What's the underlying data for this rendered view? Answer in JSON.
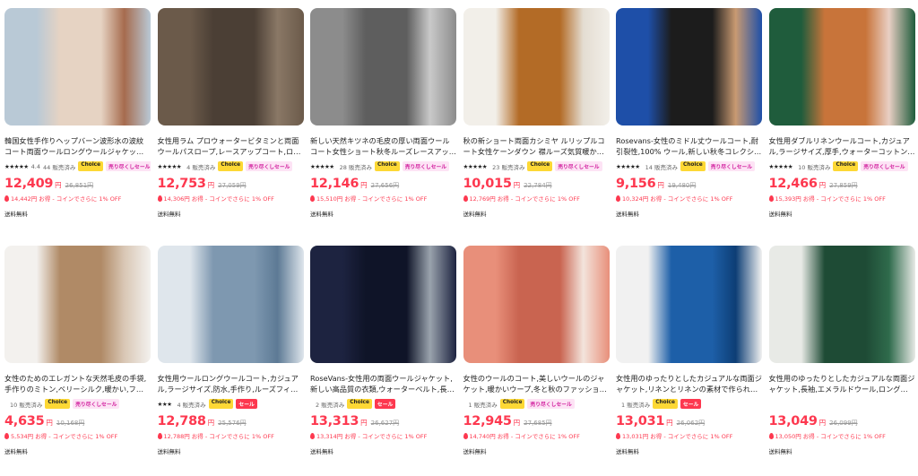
{
  "products": [
    {
      "title": "韓国女性手作りヘップバーン波形水の波紋コート両面ウールロングウールジャケットコート最大",
      "stars": "★★★★★",
      "rating": "4.4",
      "sold": "44 販売済み",
      "badges": [
        "Choice",
        "売り尽くしセール"
      ],
      "price": "12,409",
      "yen": "円",
      "old_price": "26,851円",
      "coin": "14,442円 お得 - コインでさらに 1% OFF",
      "shipping": "送料無料",
      "colors": [
        "#b9c9d6",
        "#e6d3c3",
        "#a66b4e"
      ]
    },
    {
      "title": "女性用ラム プロウォータービタミンと両面ウールパスロープ,レースアップコート,ロングウールコート,最...",
      "stars": "★★★★★",
      "rating": "",
      "sold": "4 販売済み",
      "badges": [
        "Choice",
        "売り尽くしセール"
      ],
      "price": "12,753",
      "yen": "円",
      "old_price": "27,059円",
      "coin": "14,306円 お得 - コインでさらに 1% OFF",
      "shipping": "送料無料",
      "colors": [
        "#6b5a4a",
        "#4b3f35",
        "#8a7866"
      ]
    },
    {
      "title": "新しい天然キツネの毛皮の厚い両面ウールコート女性ショート秋冬ルーズレースアップウールコ...",
      "stars": "★★★★★",
      "rating": "",
      "sold": "28 販売済み",
      "badges": [
        "Choice",
        "売り尽くしセール"
      ],
      "price": "12,146",
      "yen": "円",
      "old_price": "27,656円",
      "coin": "15,510円 お得 - コインでさらに 1% OFF",
      "shipping": "送料無料",
      "colors": [
        "#8c8c8c",
        "#5e5e5e",
        "#c9c9c9"
      ]
    },
    {
      "title": "秋の新ショート両面カシミヤ ルリップルコート女性ケーンダウン 襟ルーズ気質暖かいカジュアル...",
      "stars": "★★★★★",
      "rating": "",
      "sold": "23 販売済み",
      "badges": [
        "Choice",
        "売り尽くしセール"
      ],
      "price": "10,015",
      "yen": "円",
      "old_price": "22,784円",
      "coin": "12,769円 お得 - コインでさらに 1% OFF",
      "shipping": "送料無料",
      "colors": [
        "#f2efe9",
        "#b36b26",
        "#e4ddd2"
      ]
    },
    {
      "title": "Rosevans-女性のミドル丈ウールコート,耐引裂性,100% ウール,新しい秋冬コレクション",
      "stars": "★★★★★",
      "rating": "",
      "sold": "14 販売済み",
      "badges": [
        "Choice",
        "売り尽くしセール"
      ],
      "price": "9,156",
      "yen": "円",
      "old_price": "19,480円",
      "coin": "10,324円 お得 - コインでさらに 1% OFF",
      "shipping": "送料無料",
      "colors": [
        "#1e4fa8",
        "#1c1c1c",
        "#c99a72"
      ]
    },
    {
      "title": "女性用ダブルリネンウールコート,カジュアル,ラージサイズ,厚手,ウォーターコットン,ロングセクション,...",
      "stars": "★★★★★",
      "rating": "",
      "sold": "10 販売済み",
      "badges": [
        "Choice",
        "売り尽くしセール"
      ],
      "price": "12,466",
      "yen": "円",
      "old_price": "27,859円",
      "coin": "15,393円 お得 - コインでさらに 1% OFF",
      "shipping": "送料無料",
      "colors": [
        "#1f5c3c",
        "#c8743a",
        "#e9cfc4"
      ]
    },
    {
      "title": "女性のためのエレガントな天然毛皮の手袋,手作りのミトン,ベリーシルク,暖かい,ファッションブ...",
      "stars": "",
      "rating": "",
      "sold": "10 販売済み",
      "badges": [
        "Choice",
        "売り尽くしセール"
      ],
      "price": "4,635",
      "yen": "円",
      "old_price": "10,168円",
      "coin": "5,534円 お得 - コインでさらに 1% OFF",
      "shipping": "送料無料",
      "colors": [
        "#f3f1ee",
        "#b08a66",
        "#d9c7b5"
      ]
    },
    {
      "title": "女性用ウールロングウールコート,カジュアル,ラージサイズ,防水,手作り,ルーズフィット",
      "stars": "★★★",
      "rating": "",
      "sold": "4 販売済み",
      "badges": [
        "Choice",
        "セール"
      ],
      "price": "12,788",
      "yen": "円",
      "old_price": "25,576円",
      "coin": "12,788円 お得 - コインでさらに 1% OFF",
      "shipping": "送料無料",
      "colors": [
        "#dfe6ec",
        "#7e98b0",
        "#5d7a95"
      ]
    },
    {
      "title": "RoseVans-女性用の両面ウールジャケット,新しい高品質の衣類,ウォーターベルト,長袖,ルー...",
      "stars": "",
      "rating": "",
      "sold": "2 販売済み",
      "badges": [
        "Choice",
        "セール"
      ],
      "price": "13,313",
      "yen": "円",
      "old_price": "26,627円",
      "coin": "13,314円 お得 - コインでさらに 1% OFF",
      "shipping": "送料無料",
      "colors": [
        "#1d2340",
        "#0f1428",
        "#9aa3ad"
      ]
    },
    {
      "title": "女性のウールのコート,美しいウールのジャケット,暖かいウープ,冬と秋のファッション,ウォーター...",
      "stars": "",
      "rating": "",
      "sold": "1 販売済み",
      "badges": [
        "Choice",
        "売り尽くしセール"
      ],
      "price": "12,945",
      "yen": "円",
      "old_price": "27,685円",
      "coin": "14,740円 お得 - コインでさらに 1% OFF",
      "shipping": "送料無料",
      "colors": [
        "#e88f7a",
        "#c96450",
        "#f3e4dc"
      ]
    },
    {
      "title": "女性用のゆったりとしたカジュアルな両面ジャケット,リネンとリネンの素材で作られたゆったり...",
      "stars": "",
      "rating": "",
      "sold": "1 販売済み",
      "badges": [
        "Choice",
        "セール"
      ],
      "price": "13,031",
      "yen": "円",
      "old_price": "26,062円",
      "coin": "13,031円 お得 - コインでさらに 1% OFF",
      "shipping": "送料無料",
      "colors": [
        "#f1f1f1",
        "#1d5fa8",
        "#0d3e75"
      ]
    },
    {
      "title": "女性用のゆったりとしたカジュアルな両面ジャケット,長袖,エメラルドウール,ロングラペル,ベルト...",
      "stars": "",
      "rating": "",
      "sold": "",
      "badges": [],
      "price": "13,049",
      "yen": "円",
      "old_price": "26,099円",
      "coin": "13,050円 お得 - コインでさらに 1% OFF",
      "shipping": "送料無料",
      "colors": [
        "#e8eae6",
        "#1e4b35",
        "#2f6b4c"
      ]
    }
  ]
}
